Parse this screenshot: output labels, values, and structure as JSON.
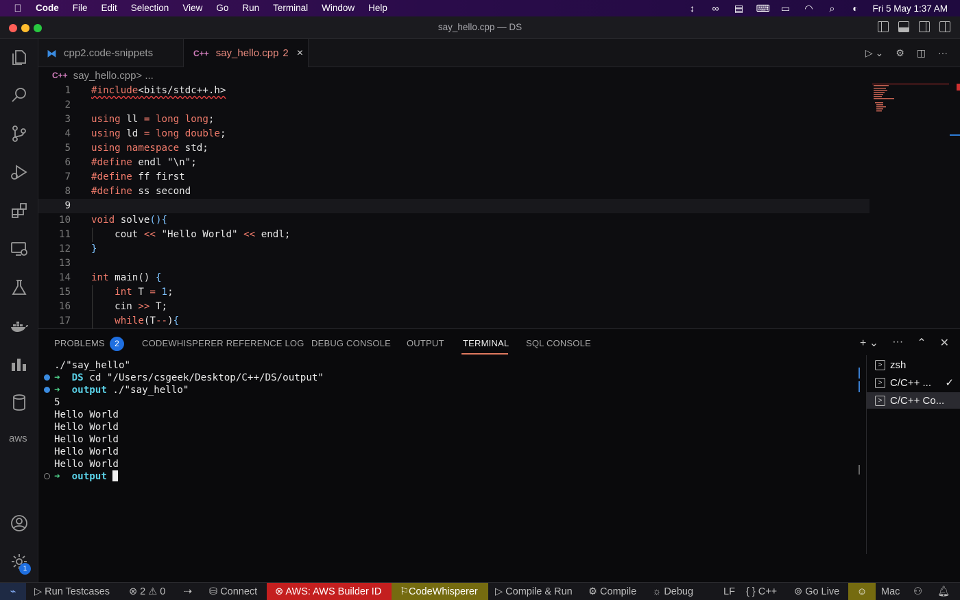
{
  "menubar": {
    "app": "Code",
    "items": [
      "File",
      "Edit",
      "Selection",
      "View",
      "Go",
      "Run",
      "Terminal",
      "Window",
      "Help"
    ],
    "clock": "Fri 5 May  1:37 AM"
  },
  "window": {
    "title": "say_hello.cpp — DS"
  },
  "tabs": [
    {
      "label": "cpp2.code-snippets"
    },
    {
      "label": "say_hello.cpp",
      "problems": "2",
      "close": "×"
    }
  ],
  "breadcrumb": {
    "file": "say_hello.cpp",
    "sep": " > ..."
  },
  "editor": {
    "lines": [
      {
        "n": "1",
        "html": "<span class=\"k squiggle\">#include</span><span class=\"squiggle\">&lt;bits/stdc++.h&gt;</span>"
      },
      {
        "n": "2",
        "html": ""
      },
      {
        "n": "3",
        "html": "<span class=\"k\">using</span> ll <span class=\"k\">=</span> <span class=\"k\">long long</span>;"
      },
      {
        "n": "4",
        "html": "<span class=\"k\">using</span> ld <span class=\"k\">=</span> <span class=\"k\">long double</span>;"
      },
      {
        "n": "5",
        "html": "<span class=\"k\">using namespace</span> std;"
      },
      {
        "n": "6",
        "html": "<span class=\"k\">#define</span> endl \"\\n\";"
      },
      {
        "n": "7",
        "html": "<span class=\"k\">#define</span> ff first"
      },
      {
        "n": "8",
        "html": "<span class=\"k\">#define</span> ss second"
      },
      {
        "n": "9",
        "html": ""
      },
      {
        "n": "10",
        "html": "<span class=\"k\">void</span> solve<span class=\"p\">(){</span>"
      },
      {
        "n": "11",
        "html": "    cout <span class=\"k\">&lt;&lt;</span> \"Hello World\" <span class=\"k\">&lt;&lt;</span> endl;"
      },
      {
        "n": "12",
        "html": "<span class=\"p\">}</span>"
      },
      {
        "n": "13",
        "html": ""
      },
      {
        "n": "14",
        "html": "<span class=\"k\">int</span> main() <span class=\"p\">{</span>"
      },
      {
        "n": "15",
        "html": "    <span class=\"k\">int</span> T <span class=\"k\">=</span> <span class=\"p\">1</span>;"
      },
      {
        "n": "16",
        "html": "    cin <span class=\"k\">&gt;&gt;</span> T;"
      },
      {
        "n": "17",
        "html": "    <span class=\"k\">while</span>(T<span class=\"k\">--</span>)<span class=\"p\">{</span>"
      }
    ],
    "current_line": "9"
  },
  "panel": {
    "tabs": [
      "PROBLEMS",
      "CODEWHISPERER REFERENCE LOG",
      "DEBUG CONSOLE",
      "OUTPUT",
      "TERMINAL",
      "SQL CONSOLE"
    ],
    "problems_count": "2",
    "active_tab": "TERMINAL"
  },
  "terminal": {
    "line0": "./\"say_hello\"",
    "cmd1_dir": "DS",
    "cmd1": " cd \"/Users/csgeek/Desktop/C++/DS/output\"",
    "cmd2_dir": "output",
    "cmd2": " ./\"say_hello\"",
    "input": "5",
    "outputs": [
      "Hello World",
      "Hello World",
      "Hello World",
      "Hello World",
      "Hello World"
    ],
    "prompt_dir": "output",
    "arrow": "➜"
  },
  "terminal_list": [
    {
      "label": "zsh"
    },
    {
      "label": "C/C++ ...",
      "check": "✓"
    },
    {
      "label": "C/C++ Co..."
    }
  ],
  "statusbar": {
    "remote": "⌁",
    "run_testcases": "▷  Run Testcases",
    "problems": "⊗ 2  ⚠ 0",
    "connect": "Connect",
    "aws": "⊗ AWS: AWS Builder ID",
    "codewhisperer": "CodeWhisperer",
    "compile_run": "▷  Compile & Run",
    "compile": "⚙ Compile",
    "debug": "Debug",
    "eol": "LF",
    "lang": "{ }  C++",
    "golive": "Go Live",
    "platform": "Mac"
  },
  "activity": {
    "settings_badge": "1",
    "aws_label": "aws"
  }
}
